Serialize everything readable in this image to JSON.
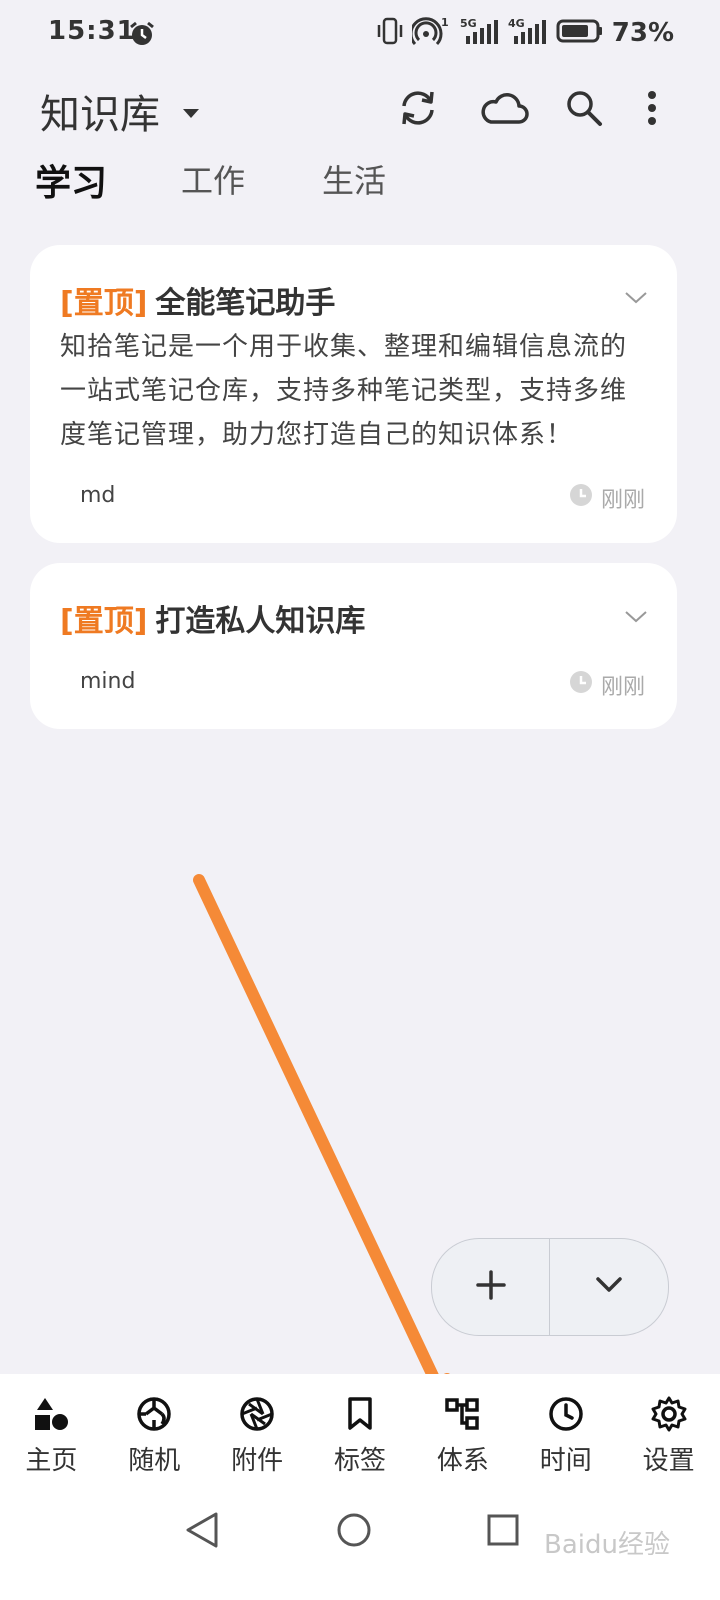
{
  "status": {
    "time": "15:31",
    "battery_pct": "73%",
    "icons": [
      "alarm-icon",
      "vibrate-icon",
      "hotspot-icon",
      "signal-5g-icon",
      "signal-4g-icon",
      "battery-icon"
    ],
    "sig1_label": "5G",
    "sig2_label": "4G",
    "hotspot_badge": "1"
  },
  "header": {
    "title": "知识库",
    "icons": [
      "sync-icon",
      "cloud-icon",
      "search-icon",
      "more-vertical-icon"
    ]
  },
  "tabs": [
    {
      "label": "学习",
      "active": true
    },
    {
      "label": "工作",
      "active": false
    },
    {
      "label": "生活",
      "active": false
    }
  ],
  "cards": [
    {
      "pin": "[置顶]",
      "title": "全能笔记助手",
      "body": "知拾笔记是一个用于收集、整理和编辑信息流的一站式笔记仓库，支持多种笔记类型，支持多维度笔记管理，助力您打造自己的知识体系！",
      "tag": "md",
      "time": "刚刚"
    },
    {
      "pin": "[置顶]",
      "title": "打造私人知识库",
      "body": "",
      "tag": "mind",
      "time": "刚刚"
    }
  ],
  "fab": {
    "icons": [
      "plus-icon",
      "chevron-down-icon"
    ]
  },
  "nav": [
    {
      "label": "主页",
      "icon": "home-shapes-icon"
    },
    {
      "label": "随机",
      "icon": "random-icon"
    },
    {
      "label": "附件",
      "icon": "aperture-icon"
    },
    {
      "label": "标签",
      "icon": "bookmark-icon"
    },
    {
      "label": "体系",
      "icon": "hierarchy-icon"
    },
    {
      "label": "时间",
      "icon": "clock-icon"
    },
    {
      "label": "设置",
      "icon": "gear-icon"
    }
  ],
  "watermark": "Baidu经验",
  "colors": {
    "background": "#f2f1f6",
    "card": "#ffffff",
    "pin_orange": "#ef7a22",
    "arrow_orange": "#f58a37"
  }
}
